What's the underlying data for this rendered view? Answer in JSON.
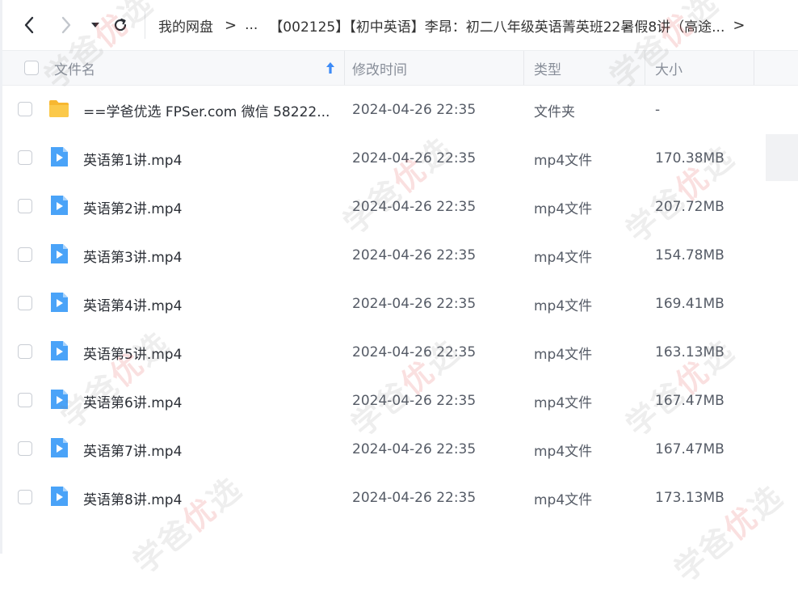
{
  "toolbar": {
    "back_icon": "chevron-left-icon",
    "forward_icon": "chevron-right-icon",
    "dropdown_icon": "caret-down-icon",
    "refresh_icon": "refresh-icon"
  },
  "breadcrumb": {
    "root": "我的网盘",
    "separator": ">",
    "ellipsis": "...",
    "current": "【002125】【初中英语】李昂：初二八年级英语菁英班22暑假8讲（高途...",
    "trailing_separator": ">"
  },
  "table": {
    "columns": {
      "name": "文件名",
      "modified": "修改时间",
      "type": "类型",
      "size": "大小"
    },
    "sort_icon": "sort-up-arrow-icon",
    "rows": [
      {
        "icon": "folder-icon",
        "name": "==学爸优选 FPSer.com 微信 58222...",
        "modified": "2024-04-26 22:35",
        "type": "文件夹",
        "size": "-"
      },
      {
        "icon": "video-file-icon",
        "name": "英语第1讲.mp4",
        "modified": "2024-04-26 22:35",
        "type": "mp4文件",
        "size": "170.38MB"
      },
      {
        "icon": "video-file-icon",
        "name": "英语第2讲.mp4",
        "modified": "2024-04-26 22:35",
        "type": "mp4文件",
        "size": "207.72MB"
      },
      {
        "icon": "video-file-icon",
        "name": "英语第3讲.mp4",
        "modified": "2024-04-26 22:35",
        "type": "mp4文件",
        "size": "154.78MB"
      },
      {
        "icon": "video-file-icon",
        "name": "英语第4讲.mp4",
        "modified": "2024-04-26 22:35",
        "type": "mp4文件",
        "size": "169.41MB"
      },
      {
        "icon": "video-file-icon",
        "name": "英语第5讲.mp4",
        "modified": "2024-04-26 22:35",
        "type": "mp4文件",
        "size": "163.13MB"
      },
      {
        "icon": "video-file-icon",
        "name": "英语第6讲.mp4",
        "modified": "2024-04-26 22:35",
        "type": "mp4文件",
        "size": "167.47MB"
      },
      {
        "icon": "video-file-icon",
        "name": "英语第7讲.mp4",
        "modified": "2024-04-26 22:35",
        "type": "mp4文件",
        "size": "167.47MB"
      },
      {
        "icon": "video-file-icon",
        "name": "英语第8讲.mp4",
        "modified": "2024-04-26 22:35",
        "type": "mp4文件",
        "size": "173.13MB"
      }
    ]
  },
  "watermark": {
    "prefix": "学爸",
    "highlight": "优",
    "suffix": "选"
  },
  "colors": {
    "accent": "#3d8bf7",
    "folder": "#f9c440",
    "video": "#4aa3f8",
    "header_bg": "#f7f8fa"
  }
}
